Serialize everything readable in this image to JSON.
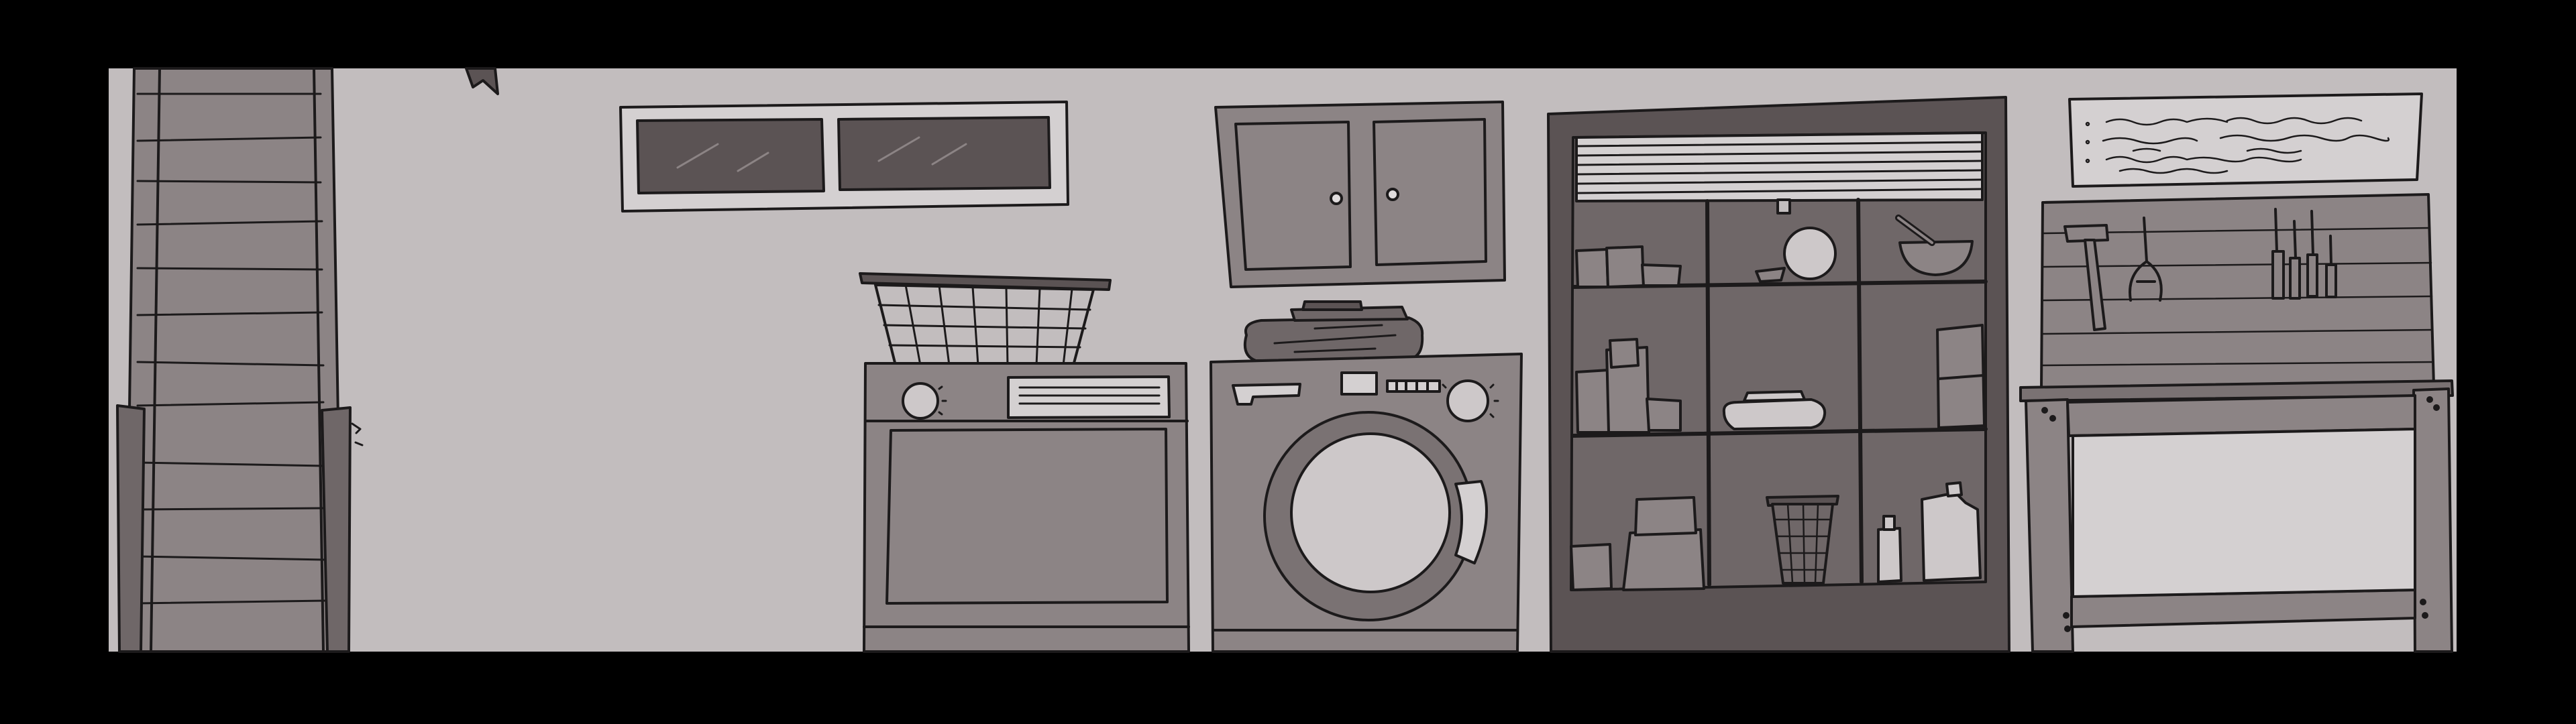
{
  "scene": {
    "title": "",
    "room": "laundry-room",
    "palette": {
      "letterbox": "#000000",
      "wall": "#c2bdbe",
      "outline": "#1c1a1b",
      "mid": "#8c8485",
      "dark": "#5b5354",
      "light": "#cdc8c9",
      "shelf_interior": "#6f6768"
    },
    "hotspots": [
      {
        "id": "stairs",
        "icon": "stairs-icon"
      },
      {
        "id": "basement-window",
        "icon": "window-icon"
      },
      {
        "id": "laundry-basket",
        "icon": "basket-icon"
      },
      {
        "id": "dryer",
        "icon": "dryer-icon"
      },
      {
        "id": "wall-cabinet",
        "icon": "cabinet-icon"
      },
      {
        "id": "folded-towels",
        "icon": "towel-icon"
      },
      {
        "id": "washing-machine",
        "icon": "washer-icon"
      },
      {
        "id": "storage-shelf",
        "icon": "shelf-icon"
      },
      {
        "id": "wall-note",
        "icon": "note-icon"
      },
      {
        "id": "pegboard-tools",
        "icon": "tools-icon"
      },
      {
        "id": "workbench",
        "icon": "workbench-icon"
      }
    ]
  }
}
